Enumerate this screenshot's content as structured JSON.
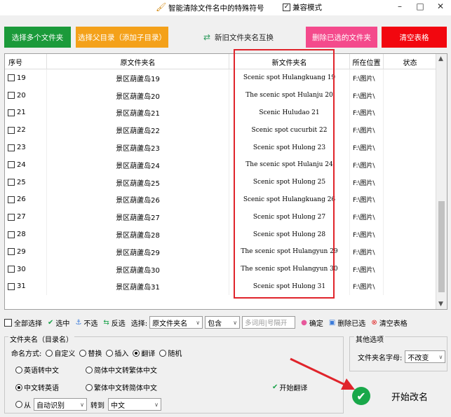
{
  "titlebar": {
    "title": "智能清除文件名中的特殊符号",
    "compat_label": "兼容模式",
    "compat_check": "✓",
    "minimize": "–",
    "maximize": "□",
    "close": "✕"
  },
  "toolbar": {
    "select_multi": "选择多个文件夹",
    "select_parent": "选择父目录（添加子目录）",
    "swap": "新旧文件夹名互换",
    "delete_selected": "删除已选的文件夹",
    "clear_table": "清空表格"
  },
  "table": {
    "headers": [
      "序号",
      "原文件夹名",
      "新文件夹名",
      "所在位置",
      "状态"
    ],
    "rows": [
      {
        "no": "19",
        "orig": "景区葫蘆岛19",
        "new": "Scenic spot Hulangkuang 19",
        "loc": "F:\\图片\\",
        "status": ""
      },
      {
        "no": "20",
        "orig": "景区葫蘆岛20",
        "new": "The scenic spot Hulanju 20",
        "loc": "F:\\图片\\",
        "status": ""
      },
      {
        "no": "21",
        "orig": "景区葫蘆岛21",
        "new": "Scenic Huludao 21",
        "loc": "F:\\图片\\",
        "status": ""
      },
      {
        "no": "22",
        "orig": "景区葫蘆岛22",
        "new": "Scenic spot cucurbit 22",
        "loc": "F:\\图片\\",
        "status": ""
      },
      {
        "no": "23",
        "orig": "景区葫蘆岛23",
        "new": "Scenic spot Hulong 23",
        "loc": "F:\\图片\\",
        "status": ""
      },
      {
        "no": "24",
        "orig": "景区葫蘆岛24",
        "new": "The scenic spot Hulanju 24",
        "loc": "F:\\图片\\",
        "status": ""
      },
      {
        "no": "25",
        "orig": "景区葫蘆岛25",
        "new": "Scenic spot Hulong 25",
        "loc": "F:\\图片\\",
        "status": ""
      },
      {
        "no": "26",
        "orig": "景区葫蘆岛26",
        "new": "Scenic spot Hulangkuang 26",
        "loc": "F:\\图片\\",
        "status": ""
      },
      {
        "no": "27",
        "orig": "景区葫蘆岛27",
        "new": "Scenic spot Hulong 27",
        "loc": "F:\\图片\\",
        "status": ""
      },
      {
        "no": "28",
        "orig": "景区葫蘆岛28",
        "new": "Scenic spot Hulong 28",
        "loc": "F:\\图片\\",
        "status": ""
      },
      {
        "no": "29",
        "orig": "景区葫蘆岛29",
        "new": "The scenic spot Hulangyun 29",
        "loc": "F:\\图片\\",
        "status": ""
      },
      {
        "no": "30",
        "orig": "景区葫蘆岛30",
        "new": "The scenic spot Hulangyun 30",
        "loc": "F:\\图片\\",
        "status": ""
      },
      {
        "no": "31",
        "orig": "景区葫蘆岛31",
        "new": "Scenic spot Hulong 31",
        "loc": "F:\\图片\\",
        "status": ""
      }
    ]
  },
  "bottombar": {
    "select_all": "全部选择",
    "select": "选中",
    "deselect": "不选",
    "invert": "反选",
    "choose_label": "选择:",
    "field_value": "原文件夹名",
    "match_value": "包含",
    "keyword_placeholder": "多词用|号隔开",
    "confirm": "确定",
    "delete_selected": "删除已选",
    "clear_table": "清空表格"
  },
  "options": {
    "group_title": "文件夹名（目录名）",
    "mode_label": "命名方式:",
    "modes": [
      "自定义",
      "替换",
      "插入",
      "翻译",
      "随机"
    ],
    "selected_mode": "翻译",
    "trans_opts": [
      "英语转中文",
      "简体中文转繁体中文",
      "中文转英语",
      "繁体中文转简体中文"
    ],
    "selected_trans": "中文转英语",
    "start_translate": "开始翻译",
    "from_label": "从",
    "from_value": "自动识别",
    "to_label": "转到",
    "to_value": "中文"
  },
  "other": {
    "title": "其他选项",
    "case_label": "文件夹名字母:",
    "case_value": "不改变"
  },
  "start": {
    "label": "开始改名"
  },
  "colors": {
    "green": "#1b9a3a",
    "orange": "#f4a11a",
    "pink": "#f44a8c",
    "red": "#f2070f",
    "highlight": "#e0242b"
  }
}
